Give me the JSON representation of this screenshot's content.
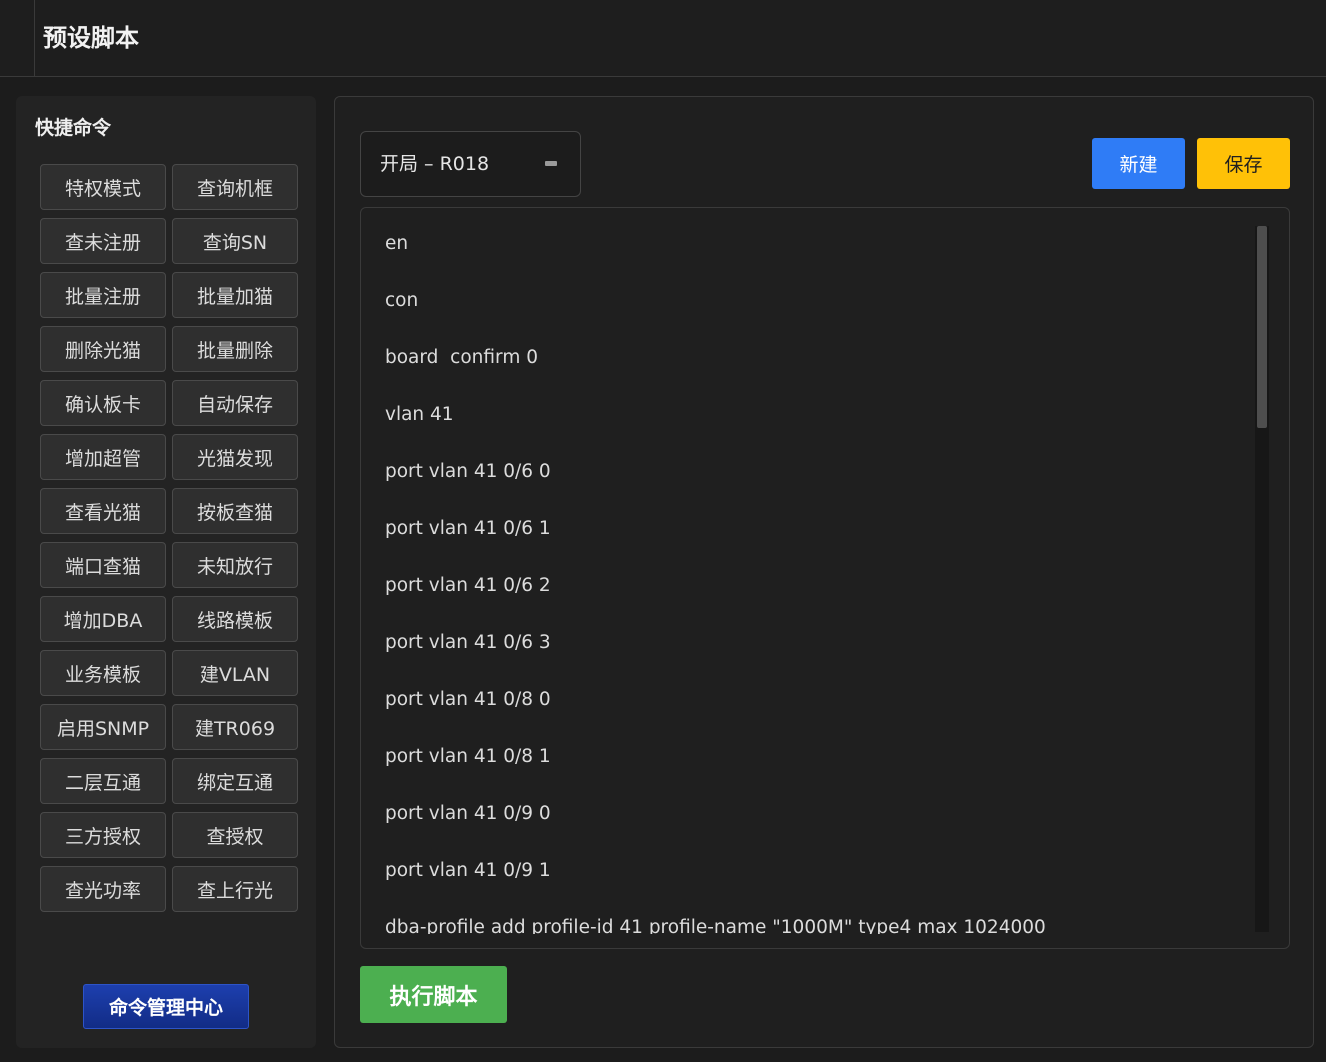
{
  "header": {
    "title": "预设脚本"
  },
  "quick_commands": {
    "title": "快捷命令",
    "buttons": [
      "特权模式",
      "查询机框",
      "查未注册",
      "查询SN",
      "批量注册",
      "批量加猫",
      "删除光猫",
      "批量删除",
      "确认板卡",
      "自动保存",
      "增加超管",
      "光猫发现",
      "查看光猫",
      "按板查猫",
      "端口查猫",
      "未知放行",
      "增加DBA",
      "线路模板",
      "业务模板",
      "建VLAN",
      "启用SNMP",
      "建TR069",
      "二层互通",
      "绑定互通",
      "三方授权",
      "查授权",
      "查光功率",
      "查上行光"
    ],
    "manage_label": "命令管理中心"
  },
  "script": {
    "selected": "开局 – R018",
    "new_label": "新建",
    "save_label": "保存",
    "run_label": "执行脚本",
    "lines": [
      "en",
      "con",
      "board  confirm 0",
      "vlan 41",
      "port vlan 41 0/6 0",
      "port vlan 41 0/6 1",
      "port vlan 41 0/6 2",
      "port vlan 41 0/6 3",
      "port vlan 41 0/8 0",
      "port vlan 41 0/8 1",
      "port vlan 41 0/9 0",
      "port vlan 41 0/9 1",
      "dba-profile add profile-id 41 profile-name \"1000M\" type4 max 1024000"
    ]
  },
  "colors": {
    "new_button": "#2f7cf6",
    "save_button": "#ffc107",
    "run_button": "#4caf50",
    "manage_button": "#1d3fae"
  },
  "icons": {
    "select_indicator": "dropdown-indicator-icon"
  }
}
